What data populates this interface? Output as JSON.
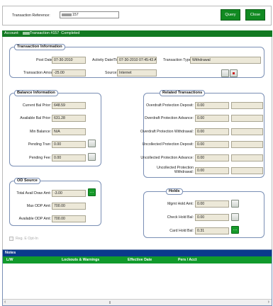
{
  "top": {
    "ref_label": "Transaction Reference:",
    "ref_value": "157",
    "query": "Query",
    "close": "Close"
  },
  "header_bar": {
    "text": "Account:          Transaction #157  Completed"
  },
  "txn_info": {
    "title": "Transaction Information",
    "post_date_label": "Post Date:",
    "post_date": "07-30-2010",
    "activity_label": "Activity Date/Time:",
    "activity": "07-30-2010 07:45:43 AM",
    "type_label": "Transaction Type:",
    "type": "Withdrawal",
    "amount_label": "Transaction Amount:",
    "amount": "-25.00",
    "source_label": "Source:",
    "source": "Internet"
  },
  "balance": {
    "title": "Balance Information",
    "rows": [
      {
        "label": "Current Bal Prior:",
        "value": "648.59"
      },
      {
        "label": "Available Bal Prior:",
        "value": "631.28"
      },
      {
        "label": "Min Balance:",
        "value": "N/A"
      },
      {
        "label": "Pending Tran:",
        "value": "0.00"
      },
      {
        "label": "Pending Fee:",
        "value": "0.00"
      }
    ]
  },
  "related": {
    "title": "Related Transactions",
    "rows": [
      {
        "label": "Overdraft Protection Deposit:",
        "value": "0.00"
      },
      {
        "label": "Overdraft Protection Advance:",
        "value": "0.00"
      },
      {
        "label": "Overdraft Protection Withdrawal:",
        "value": "0.00"
      },
      {
        "label": "Uncollected Protection Deposit:",
        "value": "0.00"
      },
      {
        "label": "Uncollected Protection Advance:",
        "value": "0.00"
      },
      {
        "label": "Uncollected Protection Withdrawal:",
        "value": "0.00"
      }
    ]
  },
  "od_source": {
    "title": "OD Source",
    "rows": [
      {
        "label": "Total Avail Draw Amt:",
        "value": "-3.00"
      },
      {
        "label": "Max ODP Amt:",
        "value": "700.00"
      },
      {
        "label": "Available ODP Amt:",
        "value": "700.00"
      }
    ]
  },
  "holds": {
    "title": "Holds",
    "rows": [
      {
        "label": "Mgmt Hold Amt:",
        "value": "0.00"
      },
      {
        "label": "Check Hold Bal:",
        "value": "0.00"
      },
      {
        "label": "Card Hold Bal:",
        "value": "0.31"
      }
    ]
  },
  "reg_e": "Reg. E Opt-In",
  "notes": {
    "title": "Notes",
    "columns": [
      "L/W",
      "Lockouts & Warnings",
      "Effective Date",
      "Pers / Acct"
    ]
  },
  "icons": {
    "ellipsis": "…",
    "nav_left": "‹",
    "nav_right": "›"
  },
  "colors": {
    "accent_green": "#118a22",
    "notes_blue": "#0a3a8c",
    "header_green": "#127a22"
  }
}
